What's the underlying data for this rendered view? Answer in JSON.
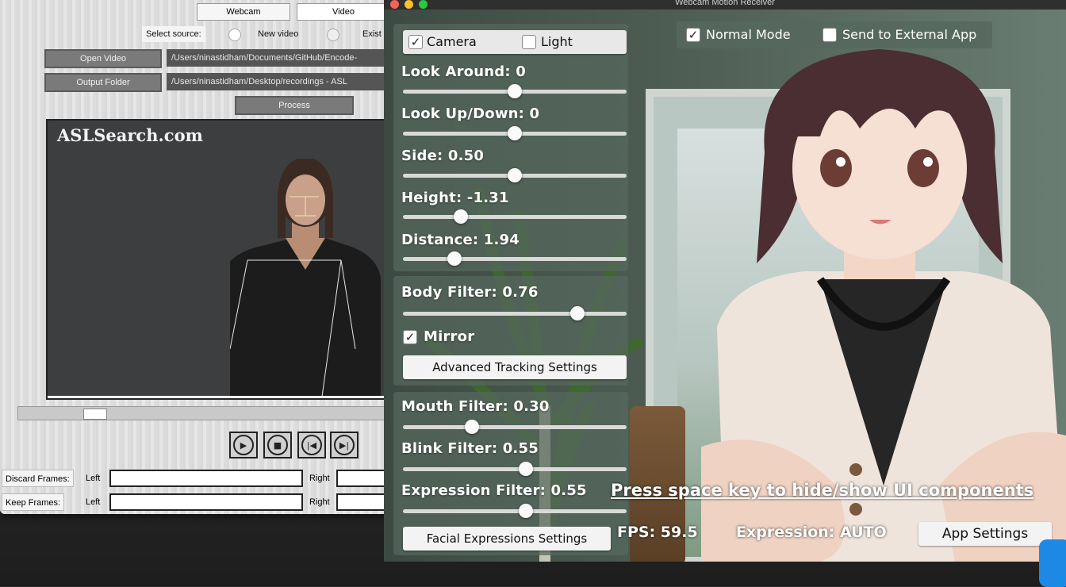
{
  "left_window": {
    "tabs": [
      "Webcam",
      "Video"
    ],
    "select_source_label": "Select source:",
    "source_options": [
      "New video",
      "Exist"
    ],
    "open_video_button": "Open Video",
    "open_video_path": "/Users/ninastidham/Documents/GitHub/Encode-",
    "output_folder_button": "Output Folder",
    "output_folder_path": "/Users/ninastidham/Desktop/recordings - ASL",
    "process_button": "Process",
    "video_watermark": "ASLSearch.com",
    "playback_buttons": [
      "play",
      "stop",
      "skip-back",
      "skip-forward"
    ],
    "discard_frames_label": "Discard Frames:",
    "keep_frames_label": "Keep Frames:",
    "left_label": "Left",
    "right_label": "Right"
  },
  "right_window": {
    "title": "Webcam Motion Receiver",
    "camera_label": "Camera",
    "camera_checked": true,
    "light_label": "Light",
    "light_checked": false,
    "sliders_camera": [
      {
        "label": "Look Around: 0",
        "value": 0.5
      },
      {
        "label": "Look Up/Down: 0",
        "value": 0.5
      },
      {
        "label": "Side: 0.50",
        "value": 0.5
      },
      {
        "label": "Height: -1.31",
        "value": 0.26
      },
      {
        "label": "Distance: 1.94",
        "value": 0.23
      }
    ],
    "body_filter_label": "Body Filter: 0.76",
    "body_filter_value": 0.78,
    "mirror_label": "Mirror",
    "mirror_checked": true,
    "advanced_tracking_button": "Advanced Tracking Settings",
    "sliders_face": [
      {
        "label": "Mouth Filter: 0.30",
        "value": 0.31
      },
      {
        "label": "Blink Filter: 0.55",
        "value": 0.55
      },
      {
        "label": "Expression Filter: 0.55",
        "value": 0.55
      }
    ],
    "facial_expressions_button": "Facial Expressions Settings",
    "normal_mode_label": "Normal Mode",
    "normal_mode_checked": true,
    "send_external_label": "Send to External App",
    "send_external_checked": false,
    "hint_text": "Press space key to hide/show UI components",
    "fps_text": "FPS: 59.5",
    "expression_text": "Expression: AUTO",
    "app_settings_button": "App Settings"
  }
}
